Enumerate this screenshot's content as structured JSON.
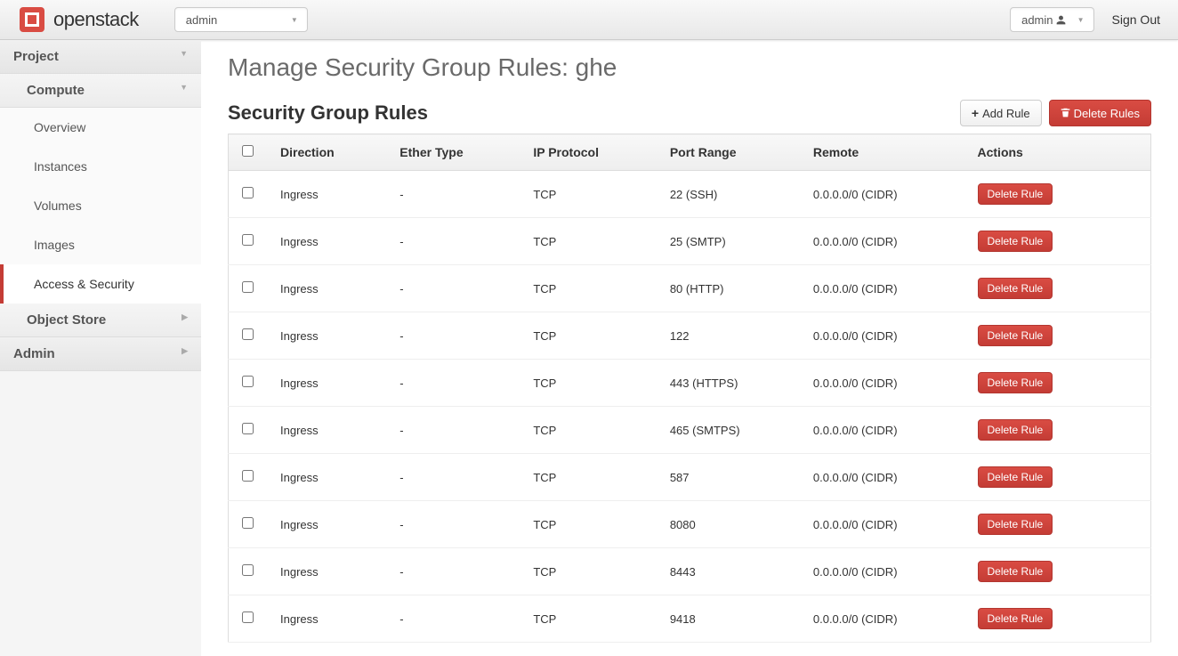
{
  "topbar": {
    "logo_text": "openstack",
    "project_selector": "admin",
    "user_selector": "admin",
    "signout": "Sign Out"
  },
  "sidebar": {
    "project": {
      "label": "Project"
    },
    "compute": {
      "label": "Compute",
      "items": [
        {
          "id": "overview",
          "label": "Overview",
          "active": false
        },
        {
          "id": "instances",
          "label": "Instances",
          "active": false
        },
        {
          "id": "volumes",
          "label": "Volumes",
          "active": false
        },
        {
          "id": "images",
          "label": "Images",
          "active": false
        },
        {
          "id": "access-security",
          "label": "Access & Security",
          "active": true
        }
      ]
    },
    "object_store": {
      "label": "Object Store"
    },
    "admin": {
      "label": "Admin"
    }
  },
  "main": {
    "title": "Manage Security Group Rules: ghe",
    "section_title": "Security Group Rules",
    "add_rule": "Add Rule",
    "delete_rules": "Delete Rules",
    "columns": {
      "direction": "Direction",
      "ether_type": "Ether Type",
      "ip_protocol": "IP Protocol",
      "port_range": "Port Range",
      "remote": "Remote",
      "actions": "Actions"
    },
    "delete_rule": "Delete Rule",
    "rules": [
      {
        "direction": "Ingress",
        "ether_type": "-",
        "ip_protocol": "TCP",
        "port_range": "22 (SSH)",
        "remote": "0.0.0.0/0 (CIDR)"
      },
      {
        "direction": "Ingress",
        "ether_type": "-",
        "ip_protocol": "TCP",
        "port_range": "25 (SMTP)",
        "remote": "0.0.0.0/0 (CIDR)"
      },
      {
        "direction": "Ingress",
        "ether_type": "-",
        "ip_protocol": "TCP",
        "port_range": "80 (HTTP)",
        "remote": "0.0.0.0/0 (CIDR)"
      },
      {
        "direction": "Ingress",
        "ether_type": "-",
        "ip_protocol": "TCP",
        "port_range": "122",
        "remote": "0.0.0.0/0 (CIDR)"
      },
      {
        "direction": "Ingress",
        "ether_type": "-",
        "ip_protocol": "TCP",
        "port_range": "443 (HTTPS)",
        "remote": "0.0.0.0/0 (CIDR)"
      },
      {
        "direction": "Ingress",
        "ether_type": "-",
        "ip_protocol": "TCP",
        "port_range": "465 (SMTPS)",
        "remote": "0.0.0.0/0 (CIDR)"
      },
      {
        "direction": "Ingress",
        "ether_type": "-",
        "ip_protocol": "TCP",
        "port_range": "587",
        "remote": "0.0.0.0/0 (CIDR)"
      },
      {
        "direction": "Ingress",
        "ether_type": "-",
        "ip_protocol": "TCP",
        "port_range": "8080",
        "remote": "0.0.0.0/0 (CIDR)"
      },
      {
        "direction": "Ingress",
        "ether_type": "-",
        "ip_protocol": "TCP",
        "port_range": "8443",
        "remote": "0.0.0.0/0 (CIDR)"
      },
      {
        "direction": "Ingress",
        "ether_type": "-",
        "ip_protocol": "TCP",
        "port_range": "9418",
        "remote": "0.0.0.0/0 (CIDR)"
      }
    ]
  }
}
